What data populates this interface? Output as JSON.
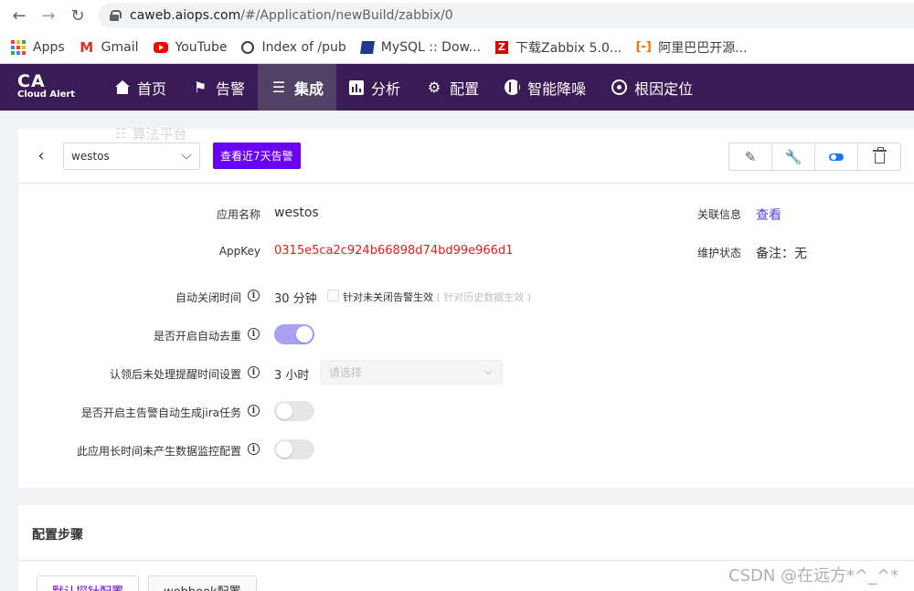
{
  "browser": {
    "url_host": "caweb.aiops.com",
    "url_path": "/#/Application/newBuild/zabbix/0",
    "bookmarks": [
      {
        "label": "Apps",
        "icon": "apps-grid-icon"
      },
      {
        "label": "Gmail",
        "icon": "gmail-icon"
      },
      {
        "label": "YouTube",
        "icon": "youtube-icon"
      },
      {
        "label": "Index of /pub",
        "icon": "globe-icon"
      },
      {
        "label": "MySQL :: Dow...",
        "icon": "mysql-icon"
      },
      {
        "label": "下载Zabbix 5.0...",
        "icon": "zabbix-icon"
      },
      {
        "label": "阿里巴巴开源...",
        "icon": "alibaba-icon"
      }
    ]
  },
  "app": {
    "logo_main": "CA",
    "logo_sub": "Cloud Alert",
    "nav": [
      {
        "label": "首页",
        "icon": "home-icon",
        "active": false
      },
      {
        "label": "告警",
        "icon": "alarm-icon",
        "active": false
      },
      {
        "label": "集成",
        "icon": "layers-icon",
        "active": true
      },
      {
        "label": "分析",
        "icon": "chart-icon",
        "active": false
      },
      {
        "label": "配置",
        "icon": "gear-icon",
        "active": false
      },
      {
        "label": "智能降噪",
        "icon": "noise-icon",
        "active": false
      },
      {
        "label": "根因定位",
        "icon": "target-icon",
        "active": false
      }
    ],
    "hover_hint": "算法平台"
  },
  "toolbar": {
    "app_select_value": "westos",
    "recent_alerts_button": "查看近7天告警",
    "actions": [
      "edit-icon",
      "wrench-icon",
      "toggle-icon",
      "trash-icon"
    ]
  },
  "details": {
    "app_name_label": "应用名称",
    "app_name_value": "westos",
    "appkey_label": "AppKey",
    "appkey_value": "0315e5ca2c924b66898d74bd99e966d1",
    "related_label": "关联信息",
    "related_link": "查看",
    "maint_label": "维护状态",
    "maint_value": "备注：无",
    "auto_close_label": "自动关闭时间",
    "auto_close_value": "30 分钟",
    "auto_close_check_label": "针对未关闭告警生效",
    "auto_close_hint": "( 针对历史数据生效 )",
    "dedupe_label": "是否开启自动去重",
    "dedupe_on": true,
    "remind_label": "认领后未处理提醒时间设置",
    "remind_value": "3 小时",
    "remind_placeholder": "请选择",
    "jira_label": "是否开启主告警自动生成jira任务",
    "jira_on": false,
    "nodata_label": "此应用长时间未产生数据监控配置",
    "nodata_on": false
  },
  "steps": {
    "title": "配置步骤",
    "tabs": [
      "默认探针配置",
      "webhook配置"
    ]
  },
  "watermark": "CSDN @在远方*^_^*"
}
